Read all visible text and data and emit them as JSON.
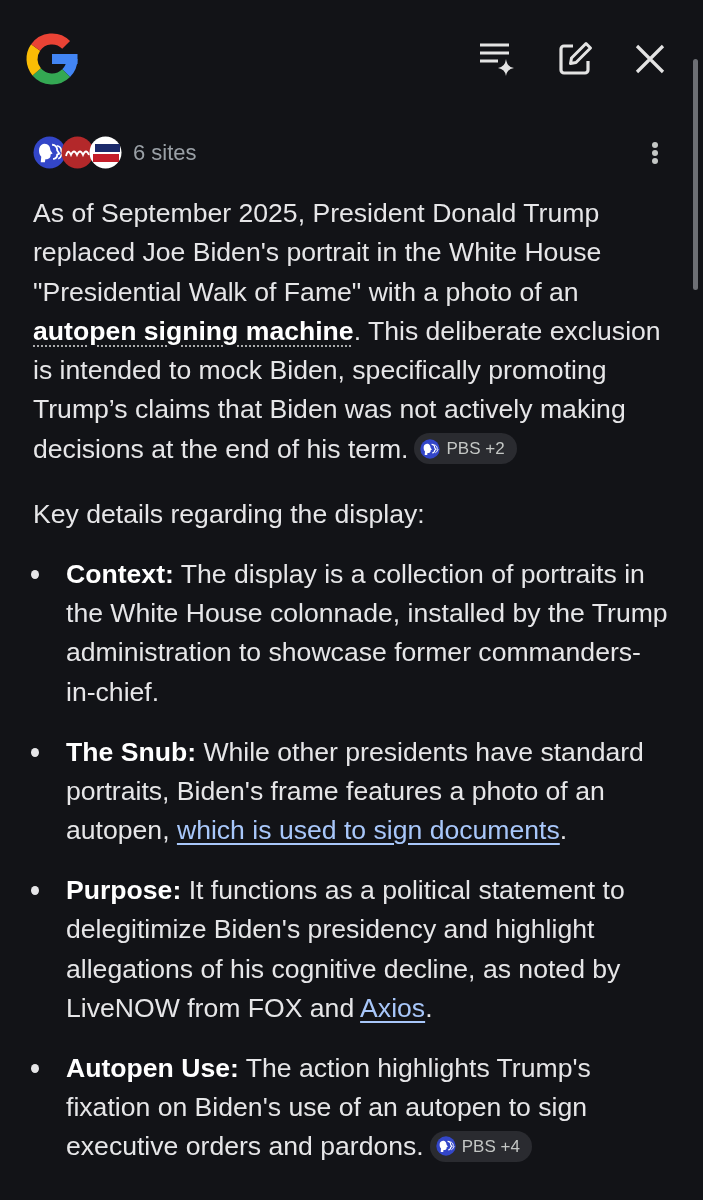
{
  "sources": {
    "label": "6 sites"
  },
  "summary": {
    "segments": [
      {
        "kind": "text",
        "text": "As of September 2025, President Donald Trump replaced Joe Biden's portrait in the White House \"Presidential Walk of Fame\" with a photo of an "
      },
      {
        "kind": "term",
        "text": "autopen signing machine"
      },
      {
        "kind": "text",
        "text": ". This deliberate exclusion is intended to mock Biden, specifically promoting Trump’s claims that Biden was not actively making decisions at the end of his term."
      }
    ],
    "citation": {
      "label": "PBS +2"
    }
  },
  "details_heading": "Key details regarding the display:",
  "details": [
    {
      "segments": [
        {
          "kind": "text",
          "text": "**Context:** The display is a collection of portraits in the White House colonnade, installed by the Trump administration to showcase former commanders-in-chief."
        }
      ]
    },
    {
      "segments": [
        {
          "kind": "text",
          "text": "**The Snub:** While other presidents have standard portraits, Biden's frame features a photo of an autopen, "
        },
        {
          "kind": "link",
          "text": "which is used to sign documents"
        },
        {
          "kind": "text",
          "text": "."
        }
      ]
    },
    {
      "segments": [
        {
          "kind": "text",
          "text": "**Purpose:** It functions as a political statement to delegitimize Biden's presidency and highlight allegations of his cognitive decline, as noted by LiveNOW from FOX and "
        },
        {
          "kind": "link",
          "text": "Axios"
        },
        {
          "kind": "text",
          "text": "."
        }
      ]
    },
    {
      "segments": [
        {
          "kind": "text",
          "text": "**Autopen Use:** The action highlights Trump's fixation on Biden's use of an autopen to sign executive orders and pardons."
        }
      ],
      "citation": {
        "label": "PBS +4"
      }
    }
  ]
}
